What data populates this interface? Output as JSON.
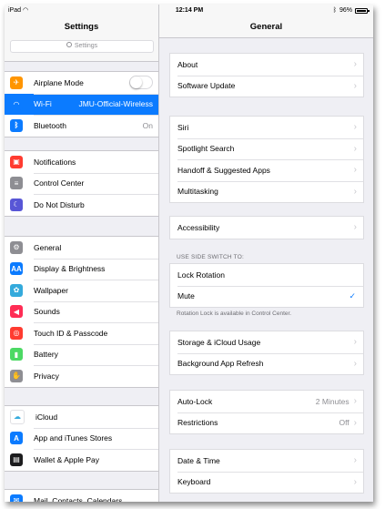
{
  "status": {
    "carrier": "iPad",
    "time": "12:14 PM",
    "battery": "96%",
    "battery_level": 0.96
  },
  "master": {
    "title": "Settings",
    "search_placeholder": "Settings",
    "groups": [
      [
        {
          "name": "airplane-mode",
          "label": "Airplane Mode",
          "icon": "airplane-icon",
          "color": "#ff9500",
          "glyph": "✈",
          "toggle": false
        },
        {
          "name": "wifi",
          "label": "Wi-Fi",
          "icon": "wifi-icon",
          "color": "#0b7bff",
          "glyph": "◠",
          "value": "JMU-Official-Wireless",
          "selected": true
        },
        {
          "name": "bluetooth",
          "label": "Bluetooth",
          "icon": "bluetooth-icon",
          "color": "#0b7bff",
          "glyph": "ᛒ",
          "value": "On"
        }
      ],
      [
        {
          "name": "notifications",
          "label": "Notifications",
          "icon": "notifications-icon",
          "color": "#ff3b30",
          "glyph": "▣"
        },
        {
          "name": "control-center",
          "label": "Control Center",
          "icon": "control-center-icon",
          "color": "#8e8e93",
          "glyph": "≡"
        },
        {
          "name": "do-not-disturb",
          "label": "Do Not Disturb",
          "icon": "moon-icon",
          "color": "#5856d6",
          "glyph": "☾"
        }
      ],
      [
        {
          "name": "general",
          "label": "General",
          "icon": "gear-icon",
          "color": "#8e8e93",
          "glyph": "⚙"
        },
        {
          "name": "display-brightness",
          "label": "Display & Brightness",
          "icon": "display-icon",
          "color": "#0b7bff",
          "glyph": "AA"
        },
        {
          "name": "wallpaper",
          "label": "Wallpaper",
          "icon": "wallpaper-icon",
          "color": "#34aadc",
          "glyph": "✿"
        },
        {
          "name": "sounds",
          "label": "Sounds",
          "icon": "speaker-icon",
          "color": "#ff2d55",
          "glyph": "◀"
        },
        {
          "name": "touch-id",
          "label": "Touch ID & Passcode",
          "icon": "fingerprint-icon",
          "color": "#ff3b30",
          "glyph": "◎"
        },
        {
          "name": "battery",
          "label": "Battery",
          "icon": "battery-icon",
          "color": "#4cd964",
          "glyph": "▮"
        },
        {
          "name": "privacy",
          "label": "Privacy",
          "icon": "hand-icon",
          "color": "#8e8e93",
          "glyph": "✋"
        }
      ],
      [
        {
          "name": "icloud",
          "label": "iCloud",
          "icon": "icloud-icon",
          "color": "#ffffff",
          "glyph": "☁",
          "glyph_color": "#34aadc"
        },
        {
          "name": "app-stores",
          "label": "App and iTunes Stores",
          "icon": "app-store-icon",
          "color": "#0b7bff",
          "glyph": "A"
        },
        {
          "name": "wallet",
          "label": "Wallet & Apple Pay",
          "icon": "wallet-icon",
          "color": "#1c1c1e",
          "glyph": "▤"
        }
      ],
      [
        {
          "name": "mail",
          "label": "Mail, Contacts, Calendars",
          "icon": "mail-icon",
          "color": "#0b7bff",
          "glyph": "✉"
        }
      ]
    ]
  },
  "detail": {
    "title": "General",
    "groups": [
      {
        "rows": [
          {
            "name": "about",
            "label": "About"
          },
          {
            "name": "software-update",
            "label": "Software Update"
          }
        ]
      },
      {
        "rows": [
          {
            "name": "siri",
            "label": "Siri"
          },
          {
            "name": "spotlight-search",
            "label": "Spotlight Search"
          },
          {
            "name": "handoff",
            "label": "Handoff & Suggested Apps"
          },
          {
            "name": "multitasking",
            "label": "Multitasking"
          }
        ]
      },
      {
        "rows": [
          {
            "name": "accessibility",
            "label": "Accessibility"
          }
        ]
      },
      {
        "header": "USE SIDE SWITCH TO:",
        "footer": "Rotation Lock is available in Control Center.",
        "rows": [
          {
            "name": "lock-rotation",
            "label": "Lock Rotation",
            "nochevron": true
          },
          {
            "name": "mute",
            "label": "Mute",
            "nochevron": true,
            "checked": true
          }
        ]
      },
      {
        "rows": [
          {
            "name": "storage",
            "label": "Storage & iCloud Usage"
          },
          {
            "name": "background-app-refresh",
            "label": "Background App Refresh"
          }
        ]
      },
      {
        "rows": [
          {
            "name": "auto-lock",
            "label": "Auto-Lock",
            "value": "2 Minutes"
          },
          {
            "name": "restrictions",
            "label": "Restrictions",
            "value": "Off"
          }
        ]
      },
      {
        "rows": [
          {
            "name": "date-time",
            "label": "Date & Time"
          },
          {
            "name": "keyboard",
            "label": "Keyboard"
          }
        ]
      }
    ]
  }
}
